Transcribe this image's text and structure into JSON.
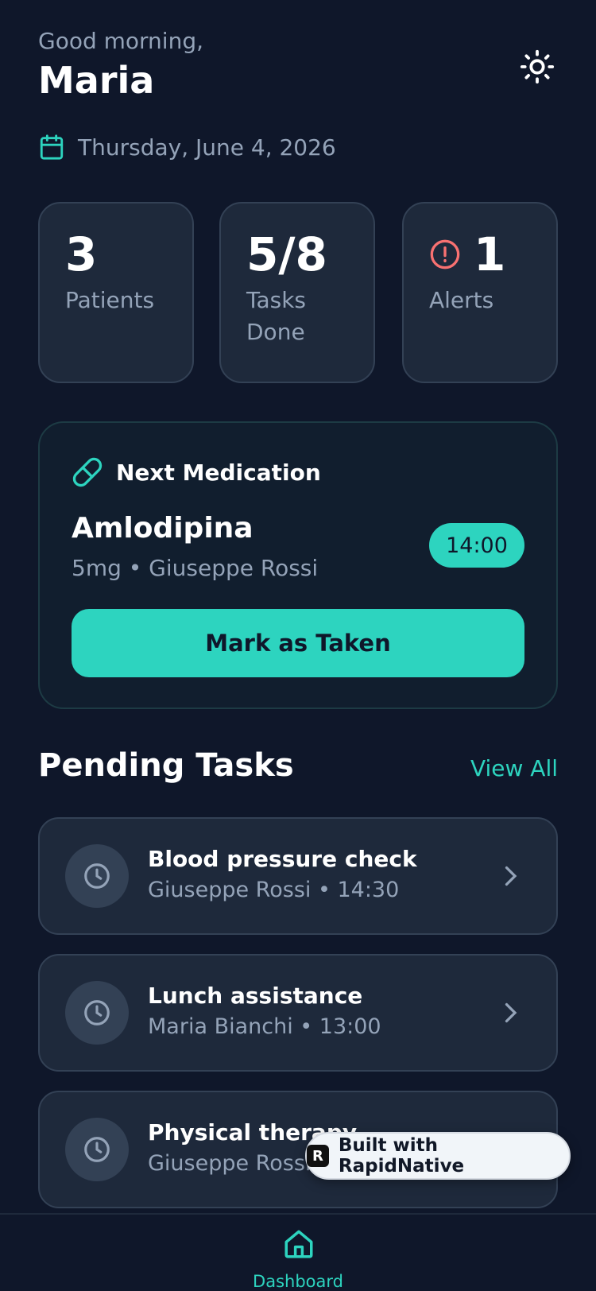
{
  "header": {
    "greeting": "Good morning,",
    "name": "Maria",
    "theme_icon": "sun-icon"
  },
  "date": {
    "icon": "calendar-icon",
    "text": "Thursday, June 4, 2026"
  },
  "stats": [
    {
      "value": "3",
      "label": "Patients"
    },
    {
      "value": "5/8",
      "label": "Tasks Done"
    },
    {
      "value": "1",
      "label": "Alerts",
      "icon": "alert-circle-icon"
    }
  ],
  "next_medication": {
    "heading": "Next Medication",
    "icon": "pill-icon",
    "name": "Amlodipina",
    "detail": "5mg • Giuseppe Rossi",
    "time": "14:00",
    "action_label": "Mark as Taken"
  },
  "pending": {
    "title": "Pending Tasks",
    "view_all": "View All",
    "tasks": [
      {
        "title": "Blood pressure check",
        "subtitle": "Giuseppe Rossi • 14:30"
      },
      {
        "title": "Lunch assistance",
        "subtitle": "Maria Bianchi • 13:00"
      },
      {
        "title": "Physical therapy",
        "subtitle": "Giuseppe Rossi"
      }
    ]
  },
  "badge": {
    "logo_letter": "R",
    "text": "Built with RapidNative"
  },
  "tabbar": {
    "home_label": "Dashboard"
  },
  "colors": {
    "background": "#0f172a",
    "card": "#1e293b",
    "accent": "#2dd4bf",
    "alert": "#f87171",
    "muted_text": "#94a3b8"
  }
}
